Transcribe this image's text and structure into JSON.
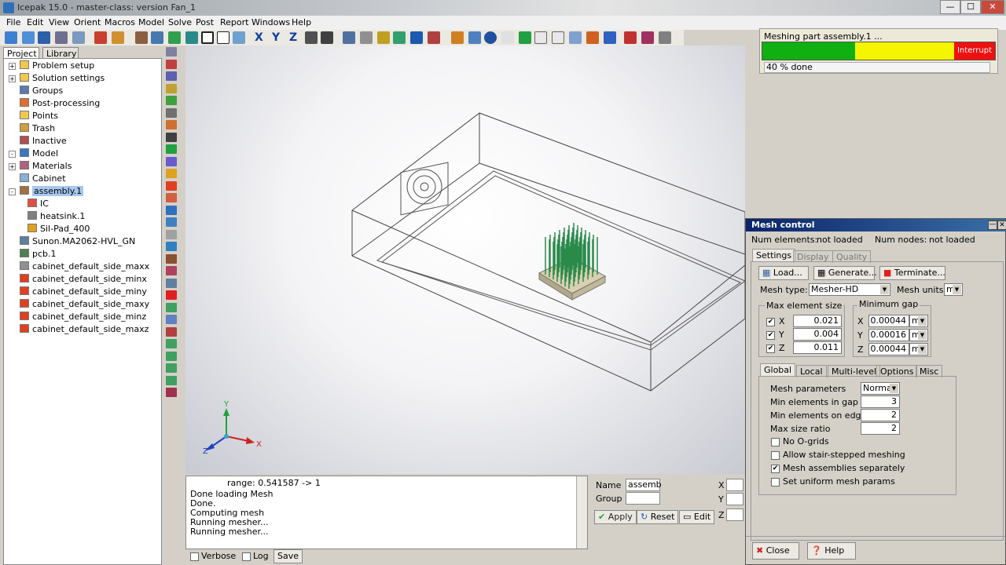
{
  "window": {
    "title": "Icepak 15.0 - master-class: version Fan_1",
    "buttons": {
      "min": "—",
      "max": "☐",
      "close": "✕"
    }
  },
  "menu": [
    "File",
    "Edit",
    "View",
    "Orient",
    "Macros",
    "Model",
    "Solve",
    "Post",
    "Report",
    "Windows",
    "Help"
  ],
  "progress": {
    "label": "Meshing part assembly.1 ...",
    "percent": 40,
    "status": "40 % done",
    "interrupt_label": "Interrupt",
    "colors": {
      "done": "#10b010",
      "pending": "#f5f500",
      "interrupt": "#f01010"
    }
  },
  "left_panel": {
    "tabs": [
      "Project",
      "Library"
    ],
    "tree": [
      {
        "label": "Problem setup",
        "icon": "folder-icon",
        "level": 1,
        "expander": "+"
      },
      {
        "label": "Solution settings",
        "icon": "folder-icon",
        "level": 1,
        "expander": "+"
      },
      {
        "label": "Groups",
        "icon": "groups-icon",
        "level": 1
      },
      {
        "label": "Post-processing",
        "icon": "post-icon",
        "level": 1
      },
      {
        "label": "Points",
        "icon": "folder-icon",
        "level": 1
      },
      {
        "label": "Trash",
        "icon": "trash-icon",
        "level": 1
      },
      {
        "label": "Inactive",
        "icon": "inactive-icon",
        "level": 1
      },
      {
        "label": "Model",
        "icon": "model-icon",
        "level": 0,
        "expander": "-"
      },
      {
        "label": "Materials",
        "icon": "materials-icon",
        "level": 1,
        "expander": "+"
      },
      {
        "label": "Cabinet",
        "icon": "cabinet-icon",
        "level": 1
      },
      {
        "label": "assembly.1",
        "icon": "assembly-icon",
        "level": 1,
        "expander": "-",
        "selected": true
      },
      {
        "label": "IC",
        "icon": "block-icon",
        "level": 2
      },
      {
        "label": "heatsink.1",
        "icon": "heatsink-icon",
        "level": 2
      },
      {
        "label": "Sil-Pad_400",
        "icon": "pad-icon",
        "level": 2
      },
      {
        "label": "Sunon.MA2062-HVL_GN",
        "icon": "fan-icon",
        "level": 1
      },
      {
        "label": "pcb.1",
        "icon": "pcb-icon",
        "level": 1
      },
      {
        "label": "cabinet_default_side_maxx",
        "icon": "wall-gray-icon",
        "level": 1
      },
      {
        "label": "cabinet_default_side_minx",
        "icon": "wall-red-icon",
        "level": 1
      },
      {
        "label": "cabinet_default_side_miny",
        "icon": "wall-red-icon",
        "level": 1
      },
      {
        "label": "cabinet_default_side_maxy",
        "icon": "wall-red-icon",
        "level": 1
      },
      {
        "label": "cabinet_default_side_minz",
        "icon": "wall-red-icon",
        "level": 1
      },
      {
        "label": "cabinet_default_side_maxz",
        "icon": "wall-red-icon",
        "level": 1
      }
    ]
  },
  "axes": {
    "x": "X",
    "y": "Y",
    "z": "Z"
  },
  "console": {
    "lines": [
      "range: 0.541587 -> 1",
      "Done loading Mesh",
      "Done.",
      "Computing mesh",
      "Running mesher...",
      "Running mesher..."
    ],
    "verbose_label": "Verbose",
    "log_label": "Log",
    "save_label": "Save"
  },
  "props": {
    "name_label": "Name",
    "name_value": "assemb",
    "group_label": "Group",
    "group_value": "",
    "apply_label": "Apply",
    "reset_label": "Reset",
    "edit_label": "Edit",
    "x_label": "X",
    "y_label": "Y",
    "z_label": "Z"
  },
  "mesh": {
    "title": "Mesh control",
    "num_elements_label": "Num elements:",
    "num_elements": "not loaded",
    "num_nodes_label": "Num nodes:",
    "num_nodes": "not loaded",
    "top_tabs": [
      "Settings",
      "Display",
      "Quality"
    ],
    "load_label": "Load...",
    "generate_label": "Generate...",
    "terminate_label": "Terminate...",
    "mesh_type_label": "Mesh type:",
    "mesh_type": "Mesher-HD",
    "mesh_units_label": "Mesh units",
    "mesh_units": "m",
    "max_elem_label": "Max element size",
    "max_x": "0.021",
    "max_y": "0.004",
    "max_z": "0.011",
    "min_gap_label": "Minimum gap",
    "gap_x": "0.00044",
    "gap_y": "0.00016",
    "gap_z": "0.00044",
    "gap_unit": "m",
    "sub_tabs": [
      "Global",
      "Local",
      "Multi-level",
      "Options",
      "Misc"
    ],
    "mesh_params_label": "Mesh parameters",
    "mesh_params": "Normal",
    "min_gap_elems_label": "Min elements in gap",
    "min_gap_elems": "3",
    "min_edge_elems_label": "Min elements on edge",
    "min_edge_elems": "2",
    "max_ratio_label": "Max size ratio",
    "max_ratio": "2",
    "opt_no_ogrids": "No O-grids",
    "opt_stair": "Allow stair-stepped meshing",
    "opt_assemblies": "Mesh assemblies separately",
    "opt_uniform": "Set uniform mesh params",
    "close_label": "Close",
    "help_label": "Help"
  }
}
